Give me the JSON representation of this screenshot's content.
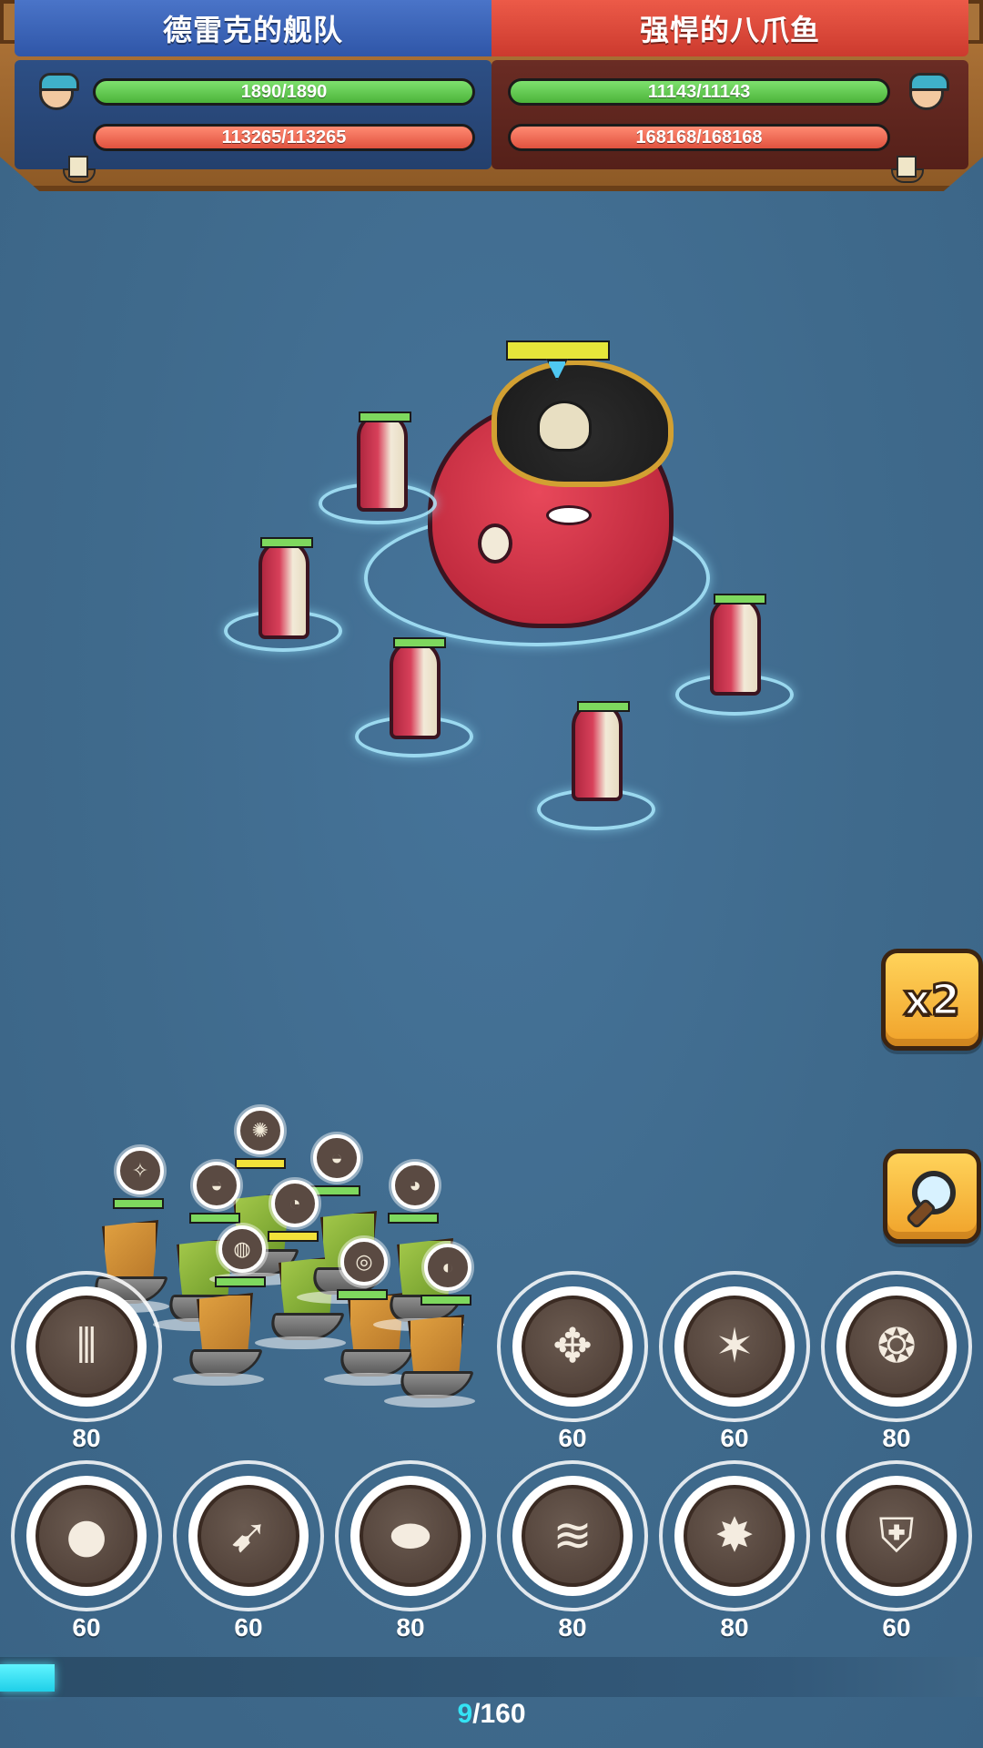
{
  "header": {
    "left_team": {
      "name": "德雷克的舰队",
      "captain_hp": "1890/1890",
      "fleet_hp": "113265/113265"
    },
    "right_team": {
      "name": "强悍的八爪鱼",
      "captain_hp": "11143/11143",
      "fleet_hp": "168168/168168"
    }
  },
  "controls": {
    "speed_label": "x2",
    "speed_icon": "speed-x2-icon",
    "inspect_icon": "magnifier-icon"
  },
  "skills": [
    {
      "icon": "cannons-icon",
      "cost": "80"
    },
    {
      "icon": "compass-icon",
      "cost": "60"
    },
    {
      "icon": "splash-icon",
      "cost": "60"
    },
    {
      "icon": "winged-shield-icon",
      "cost": "80"
    },
    {
      "icon": "cannonball-icon",
      "cost": "60"
    },
    {
      "icon": "fish-icon",
      "cost": "60"
    },
    {
      "icon": "shell-icon",
      "cost": "80"
    },
    {
      "icon": "tornado-icon",
      "cost": "80"
    },
    {
      "icon": "burst-icon",
      "cost": "80"
    },
    {
      "icon": "shield-icon",
      "cost": "60"
    }
  ],
  "energy": {
    "current": "9",
    "separator": "/",
    "max": "160",
    "fraction": 0.056
  },
  "colors": {
    "left_team": "#2f56a8",
    "right_team": "#cc3a2e",
    "hp_green": "#4cb43a",
    "hp_red": "#e0523e",
    "energy": "#34e3f4"
  }
}
